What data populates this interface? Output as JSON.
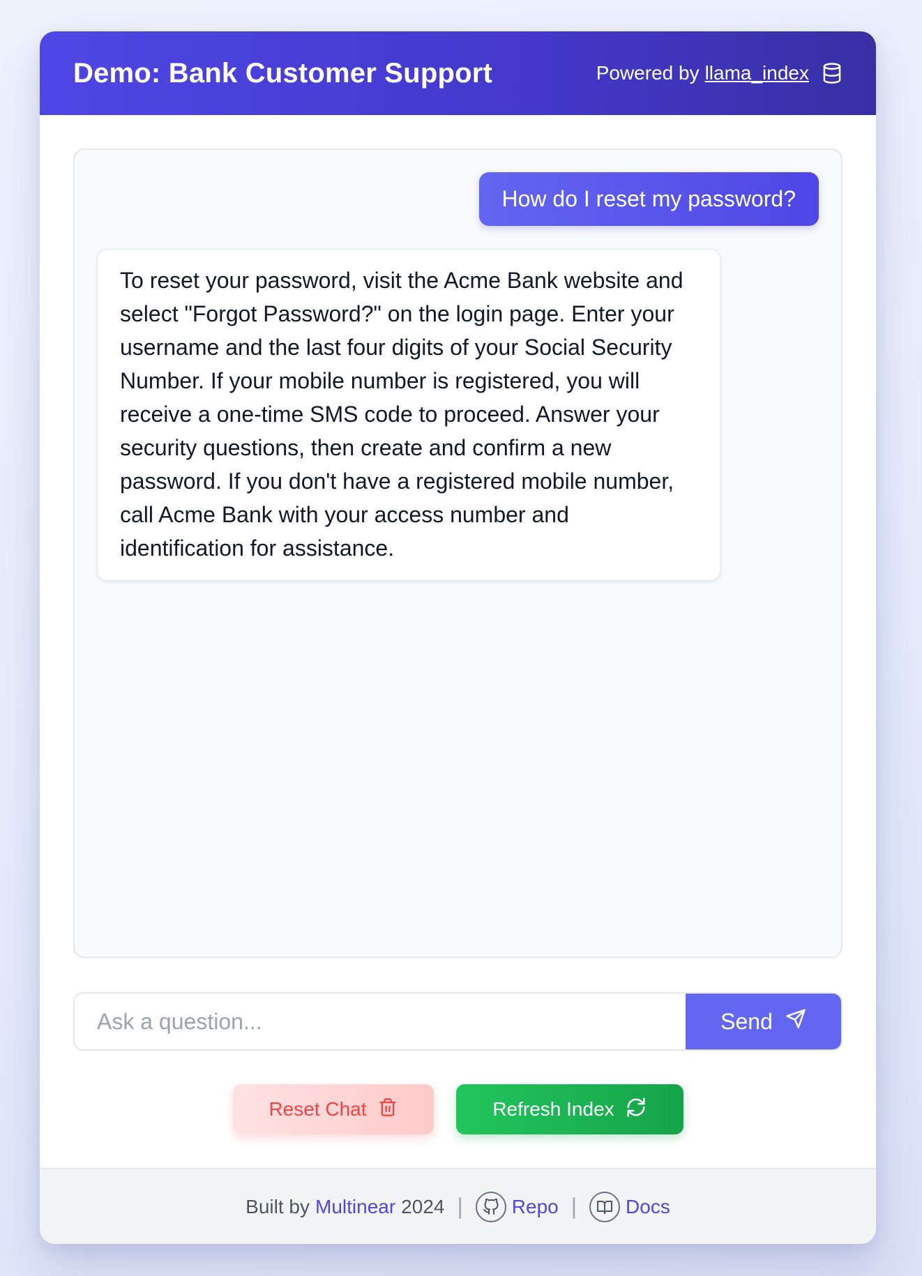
{
  "header": {
    "title": "Demo: Bank Customer Support",
    "powered_prefix": "Powered by",
    "powered_link": "llama_index",
    "icon": "database-icon"
  },
  "chat": {
    "messages": [
      {
        "role": "user",
        "text": "How do I reset my password?"
      },
      {
        "role": "assistant",
        "text": "To reset your password, visit the Acme Bank website and select \"Forgot Password?\" on the login page. Enter your username and the last four digits of your Social Security Number. If your mobile number is registered, you will receive a one-time SMS code to proceed. Answer your security questions, then create and confirm a new password. If you don't have a registered mobile number, call Acme Bank with your access number and identification for assistance."
      }
    ]
  },
  "input": {
    "placeholder": "Ask a question...",
    "value": "",
    "send_label": "Send",
    "send_icon": "send-icon"
  },
  "actions": {
    "reset_label": "Reset Chat",
    "reset_icon": "trash-icon",
    "refresh_label": "Refresh Index",
    "refresh_icon": "refresh-icon"
  },
  "footer": {
    "built_by": "Built by",
    "brand": "Multinear",
    "year": "2024",
    "separator": "|",
    "repo_label": "Repo",
    "repo_icon": "github-icon",
    "docs_label": "Docs",
    "docs_icon": "book-icon"
  },
  "colors": {
    "primary": "#4f46e5",
    "send": "#6366f1",
    "danger": "#ef4444",
    "success": "#16a34a"
  }
}
